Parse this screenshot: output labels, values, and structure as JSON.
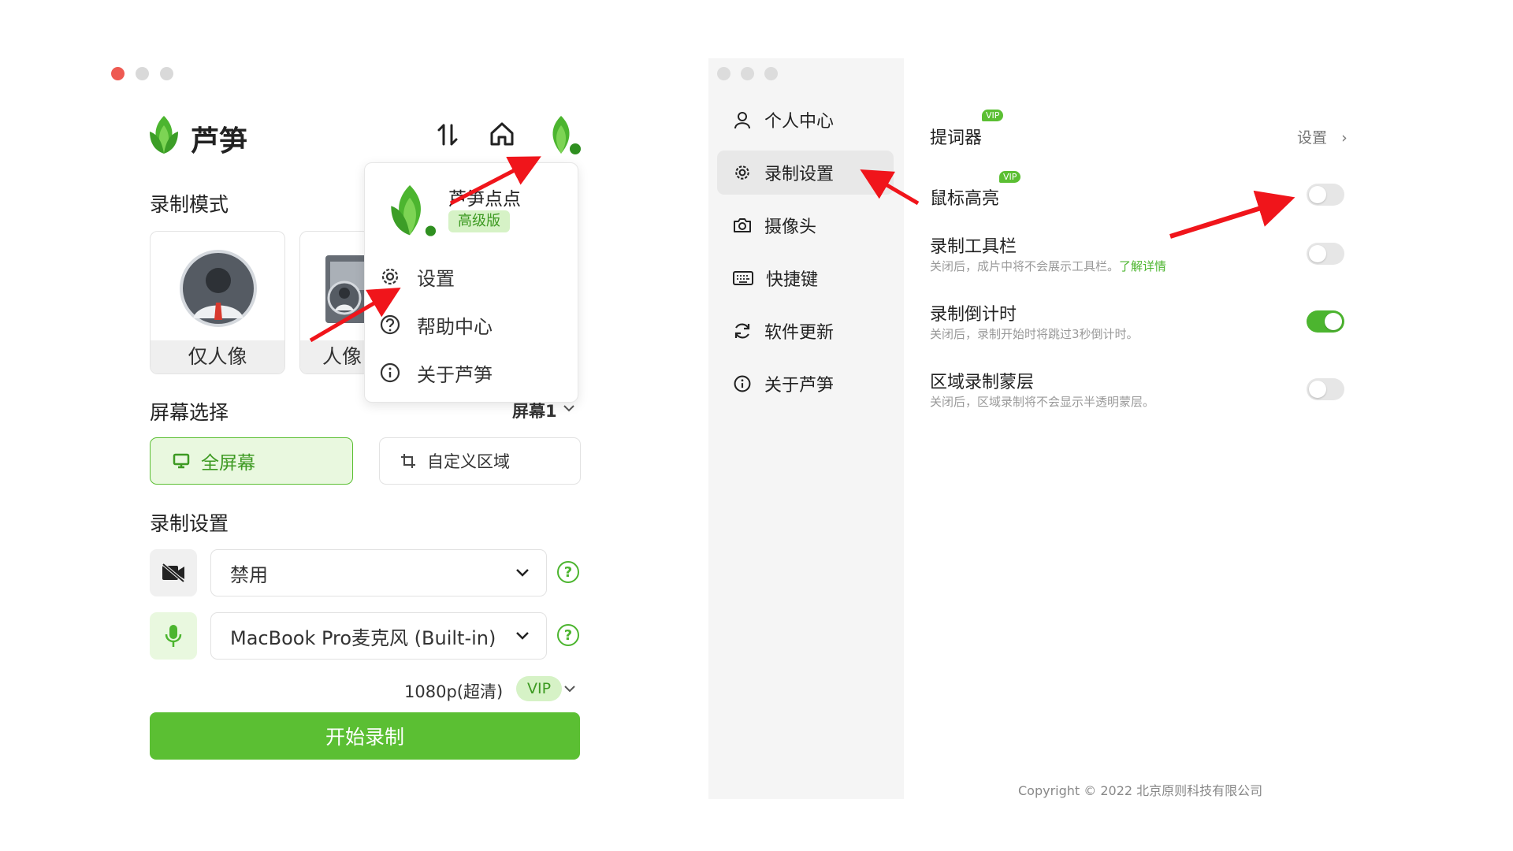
{
  "left_window": {
    "app_name": "芦笋",
    "section_mode": "录制模式",
    "modes": [
      {
        "label": "仅人像"
      },
      {
        "label": "人像+"
      }
    ],
    "section_screen": "屏幕选择",
    "screen_select_value": "屏幕1",
    "screen_options": [
      {
        "label": "全屏幕"
      },
      {
        "label": "自定义区域"
      }
    ],
    "section_record": "录制设置",
    "camera_value": "禁用",
    "mic_value": "MacBook Pro麦克风 (Built-in)",
    "help_symbol": "?",
    "resolution": "1080p(超清)",
    "vip_badge": "VIP",
    "start_button": "开始录制"
  },
  "dropdown": {
    "user_name": "芦笋点点",
    "plan_badge": "高级版",
    "items": [
      {
        "label": "设置",
        "icon": "gear-icon"
      },
      {
        "label": "帮助中心",
        "icon": "question-icon"
      },
      {
        "label": "关于芦笋",
        "icon": "info-icon"
      }
    ]
  },
  "settings_window": {
    "nav": [
      {
        "label": "个人中心",
        "icon": "person-icon"
      },
      {
        "label": "录制设置",
        "icon": "gear-icon"
      },
      {
        "label": "摄像头",
        "icon": "camera-icon"
      },
      {
        "label": "快捷键",
        "icon": "keyboard-icon"
      },
      {
        "label": "软件更新",
        "icon": "refresh-icon"
      },
      {
        "label": "关于芦笋",
        "icon": "info-icon"
      }
    ],
    "active_nav": "录制设置",
    "vip_tag": "VIP",
    "prompter": {
      "title": "提词器",
      "link": "设置",
      "chevron": "›"
    },
    "rows": [
      {
        "title": "鼠标高亮",
        "desc": "",
        "on": false
      },
      {
        "title": "录制工具栏",
        "desc": "关闭后，成片中将不会展示工具栏。",
        "link": "了解详情",
        "on": false
      },
      {
        "title": "录制倒计时",
        "desc": "关闭后，录制开始时将跳过3秒倒计时。",
        "on": true
      },
      {
        "title": "区域录制蒙层",
        "desc": "关闭后，区域录制将不会显示半透明蒙层。",
        "on": false
      }
    ],
    "copyright": "Copyright © 2022 北京原则科技有限公司"
  },
  "colors": {
    "accent_green": "#5bbf33",
    "close_red": "#ee5a52",
    "arrow_red": "#f0151b"
  }
}
